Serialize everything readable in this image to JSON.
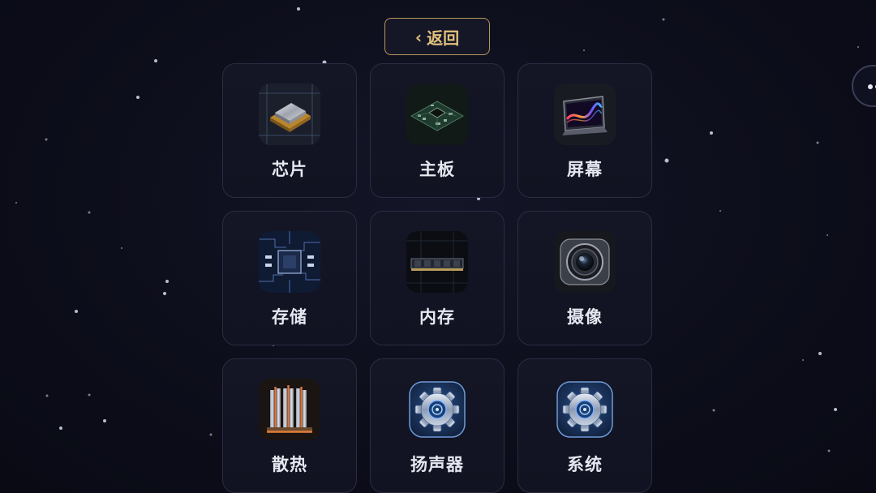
{
  "back_button": {
    "label": "返回",
    "icon": "chevron-left-icon"
  },
  "categories": [
    {
      "label": "芯片",
      "icon": "cpu-chip-icon"
    },
    {
      "label": "主板",
      "icon": "motherboard-icon"
    },
    {
      "label": "屏幕",
      "icon": "screen-icon"
    },
    {
      "label": "存储",
      "icon": "storage-circuit-icon"
    },
    {
      "label": "内存",
      "icon": "memory-ram-icon"
    },
    {
      "label": "摄像",
      "icon": "camera-lens-icon"
    },
    {
      "label": "散热",
      "icon": "heatsink-icon"
    },
    {
      "label": "扬声器",
      "icon": "gear-icon"
    },
    {
      "label": "系统",
      "icon": "gear-icon"
    }
  ],
  "colors": {
    "background": "#0c0d18",
    "accent_gold": "#e3c27e",
    "card_border": "#2a2d42",
    "label_text": "#e6e8f0"
  }
}
